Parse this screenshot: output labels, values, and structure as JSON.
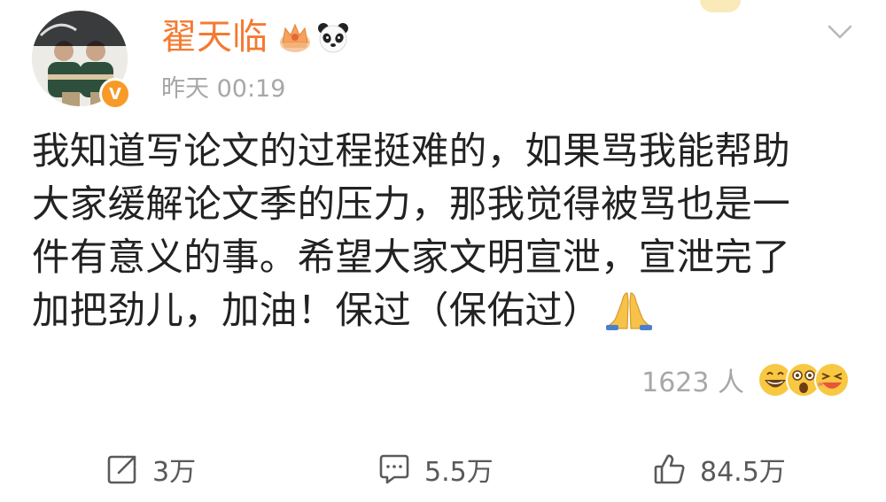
{
  "post": {
    "author": {
      "name": "翟天临",
      "verified_mark": "V",
      "badges": [
        "crown-icon",
        "panda-icon"
      ]
    },
    "timestamp": "昨天 00:19",
    "lines": [
      "我知道写论文的过程挺难的，如果骂我能帮助",
      "大家缓解论文季的压力，那我觉得被骂也是一",
      "件有意义的事。希望大家文明宣泄，宣泄完了",
      "加把劲儿，加油！保过（保佑过）"
    ],
    "trailing_icon": "praying-hands-icon",
    "reactions": {
      "count_text": "1623 人",
      "icons": [
        "grinning-face-icon",
        "astonished-face-icon",
        "laughing-face-icon"
      ]
    }
  },
  "actions": {
    "repost": {
      "count": "3万",
      "icon": "repost-icon"
    },
    "comment": {
      "count": "5.5万",
      "icon": "comment-icon"
    },
    "like": {
      "count": "84.5万",
      "icon": "thumbs-up-icon"
    }
  },
  "colors": {
    "username": "#f47a32",
    "verified": "#f79a27",
    "muted_text": "#a7a7a7",
    "body_text": "#222222",
    "action_text": "#595959"
  }
}
